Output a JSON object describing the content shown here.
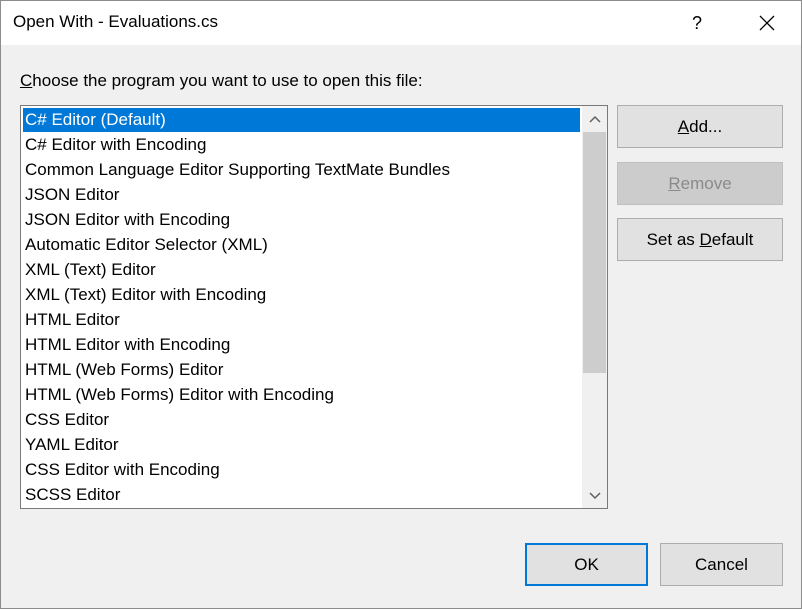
{
  "window": {
    "title": "Open With - Evaluations.cs",
    "help_label": "?"
  },
  "prompt": {
    "mnemonic": "C",
    "rest": "hoose the program you want to use to open this file:"
  },
  "programs": [
    "C# Editor (Default)",
    "C# Editor with Encoding",
    "Common Language Editor Supporting TextMate Bundles",
    "JSON Editor",
    "JSON Editor with Encoding",
    "Automatic Editor Selector (XML)",
    "XML (Text) Editor",
    "XML (Text) Editor with Encoding",
    "HTML Editor",
    "HTML Editor with Encoding",
    "HTML (Web Forms) Editor",
    "HTML (Web Forms) Editor with Encoding",
    "CSS Editor",
    "YAML Editor",
    "CSS Editor with Encoding",
    "SCSS Editor"
  ],
  "selected_index": 0,
  "buttons": {
    "add": {
      "mnemonic": "A",
      "rest": "dd..."
    },
    "remove": {
      "mnemonic": "R",
      "rest": "emove"
    },
    "set_default": {
      "before": "Set as ",
      "mnemonic": "D",
      "rest": "efault"
    },
    "ok": "OK",
    "cancel": "Cancel"
  },
  "colors": {
    "selection": "#0078d7",
    "default_button_border": "#0078d7",
    "dialog_bg": "#f0f0f0"
  },
  "icons": {
    "close": "close-icon",
    "scroll_up": "chevron-up-icon",
    "scroll_down": "chevron-down-icon"
  }
}
